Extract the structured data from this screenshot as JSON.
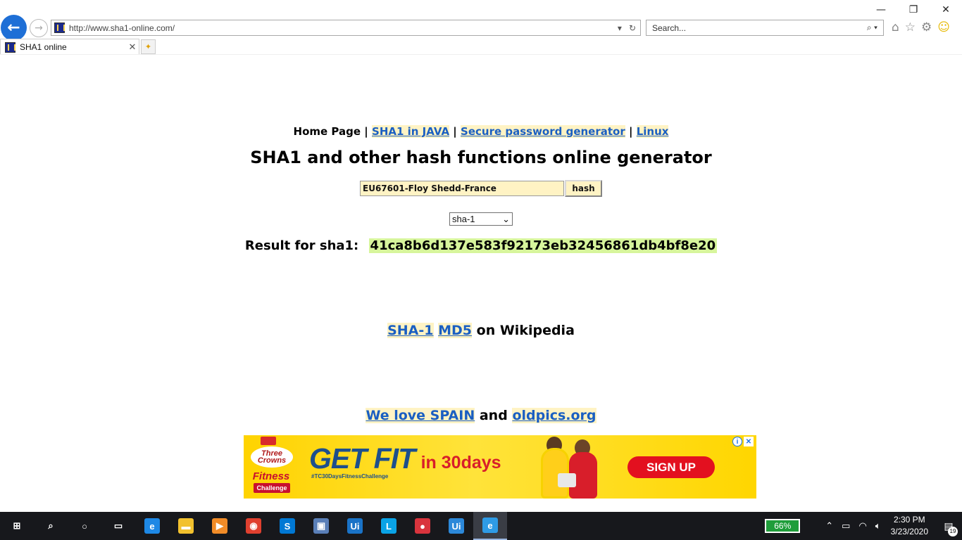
{
  "browser": {
    "url": "http://www.sha1-online.com/",
    "search_placeholder": "Search...",
    "tab_title": "SHA1 online",
    "window_controls": {
      "minimize": "—",
      "restore": "❐",
      "close": "✕"
    }
  },
  "page": {
    "nav": {
      "home": "Home Page",
      "separator": "|",
      "link1": "SHA1 in JAVA",
      "link2": "Secure password generator",
      "link3": "Linux"
    },
    "title": "SHA1 and other hash functions online generator",
    "form": {
      "input_value": "EU67601-Floy Shedd-France",
      "button_label": "hash",
      "algorithm_selected": "sha-1"
    },
    "result": {
      "label": "Result for sha1:",
      "hash": "41ca8b6d137e583f92173eb32456861db4bf8e20"
    },
    "wiki": {
      "link1": "SHA-1",
      "link2": "MD5",
      "suffix": "on Wikipedia"
    },
    "love": {
      "link1": "We love SPAIN",
      "conjunction": "and",
      "link2": "oldpics.org"
    }
  },
  "ad": {
    "brand_line1": "Three Crowns",
    "brand_line2": "Fitness",
    "brand_line3": "Challenge",
    "headline": "GET FIT",
    "headline_suffix": "in 30days",
    "hashtag": "#TC30DaysFitnessChallenge",
    "cta": "SIGN UP",
    "info_glyph": "i",
    "close_glyph": "✕"
  },
  "taskbar": {
    "apps": [
      {
        "name": "start-icon",
        "glyph": "⊞"
      },
      {
        "name": "search-icon",
        "glyph": "⌕"
      },
      {
        "name": "cortana-icon",
        "glyph": "○"
      },
      {
        "name": "task-view-icon",
        "glyph": "▭"
      },
      {
        "name": "edge-icon",
        "glyph": "e",
        "color": "#1e88e5"
      },
      {
        "name": "file-explorer-icon",
        "glyph": "▬",
        "color": "#f2c12e"
      },
      {
        "name": "media-player-icon",
        "glyph": "▶",
        "color": "#f28c28"
      },
      {
        "name": "chrome-icon",
        "glyph": "◉",
        "color": "#e0402f"
      },
      {
        "name": "skype-icon",
        "glyph": "S",
        "color": "#0078d4"
      },
      {
        "name": "remote-desktop-icon",
        "glyph": "▣",
        "color": "#5a7fb8"
      },
      {
        "name": "uipath-studio-icon",
        "glyph": "Ui",
        "color": "#1a73c7"
      },
      {
        "name": "l-app-icon",
        "glyph": "L",
        "color": "#0aa3e6"
      },
      {
        "name": "screen-recorder-icon",
        "glyph": "●",
        "color": "#d9343d"
      },
      {
        "name": "uipath-robot-icon",
        "glyph": "Ui",
        "color": "#2c88d9"
      },
      {
        "name": "internet-explorer-icon",
        "glyph": "e",
        "color": "#2e9be6"
      }
    ],
    "battery": "66%",
    "time": "2:30 PM",
    "date": "3/23/2020",
    "notification_count": "19"
  }
}
